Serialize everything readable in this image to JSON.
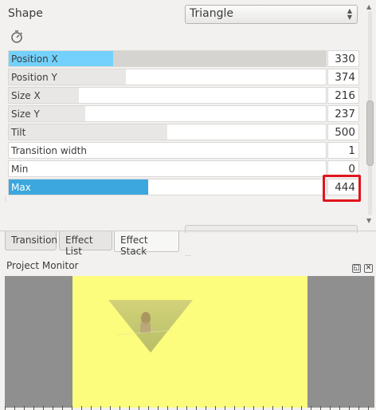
{
  "effect": {
    "shape_label": "Shape",
    "shape_value": "Triangle",
    "reset_icon": "stopwatch-icon",
    "params": [
      {
        "label": "Position X",
        "value": "330",
        "fill_fraction": 0.33
      },
      {
        "label": "Position Y",
        "value": "374",
        "fill_fraction": 0.37
      },
      {
        "label": "Size X",
        "value": "216",
        "fill_fraction": 0.22
      },
      {
        "label": "Size Y",
        "value": "237",
        "fill_fraction": 0.24
      },
      {
        "label": "Tilt",
        "value": "500",
        "fill_fraction": 0.5
      },
      {
        "label": "Transition width",
        "value": "1",
        "fill_fraction": 0.0
      },
      {
        "label": "Min",
        "value": "0",
        "fill_fraction": 0.0
      },
      {
        "label": "Max",
        "value": "444",
        "fill_fraction": 0.44
      }
    ],
    "highlighted_param": "Max"
  },
  "tabs": [
    {
      "label": "Transition",
      "active": false
    },
    {
      "label": "Effect List",
      "active": false
    },
    {
      "label": "Effect Stack",
      "active": true
    }
  ],
  "monitor": {
    "title": "Project Monitor",
    "float_icon": "float-icon",
    "close_icon": "close-icon"
  },
  "colors": {
    "highlight": "#e0141c",
    "active_slider": "#73d1fb",
    "selected_slider": "#3ba7de",
    "frame_background": "#fcfc7d",
    "monitor_background": "#8f8f8f"
  }
}
